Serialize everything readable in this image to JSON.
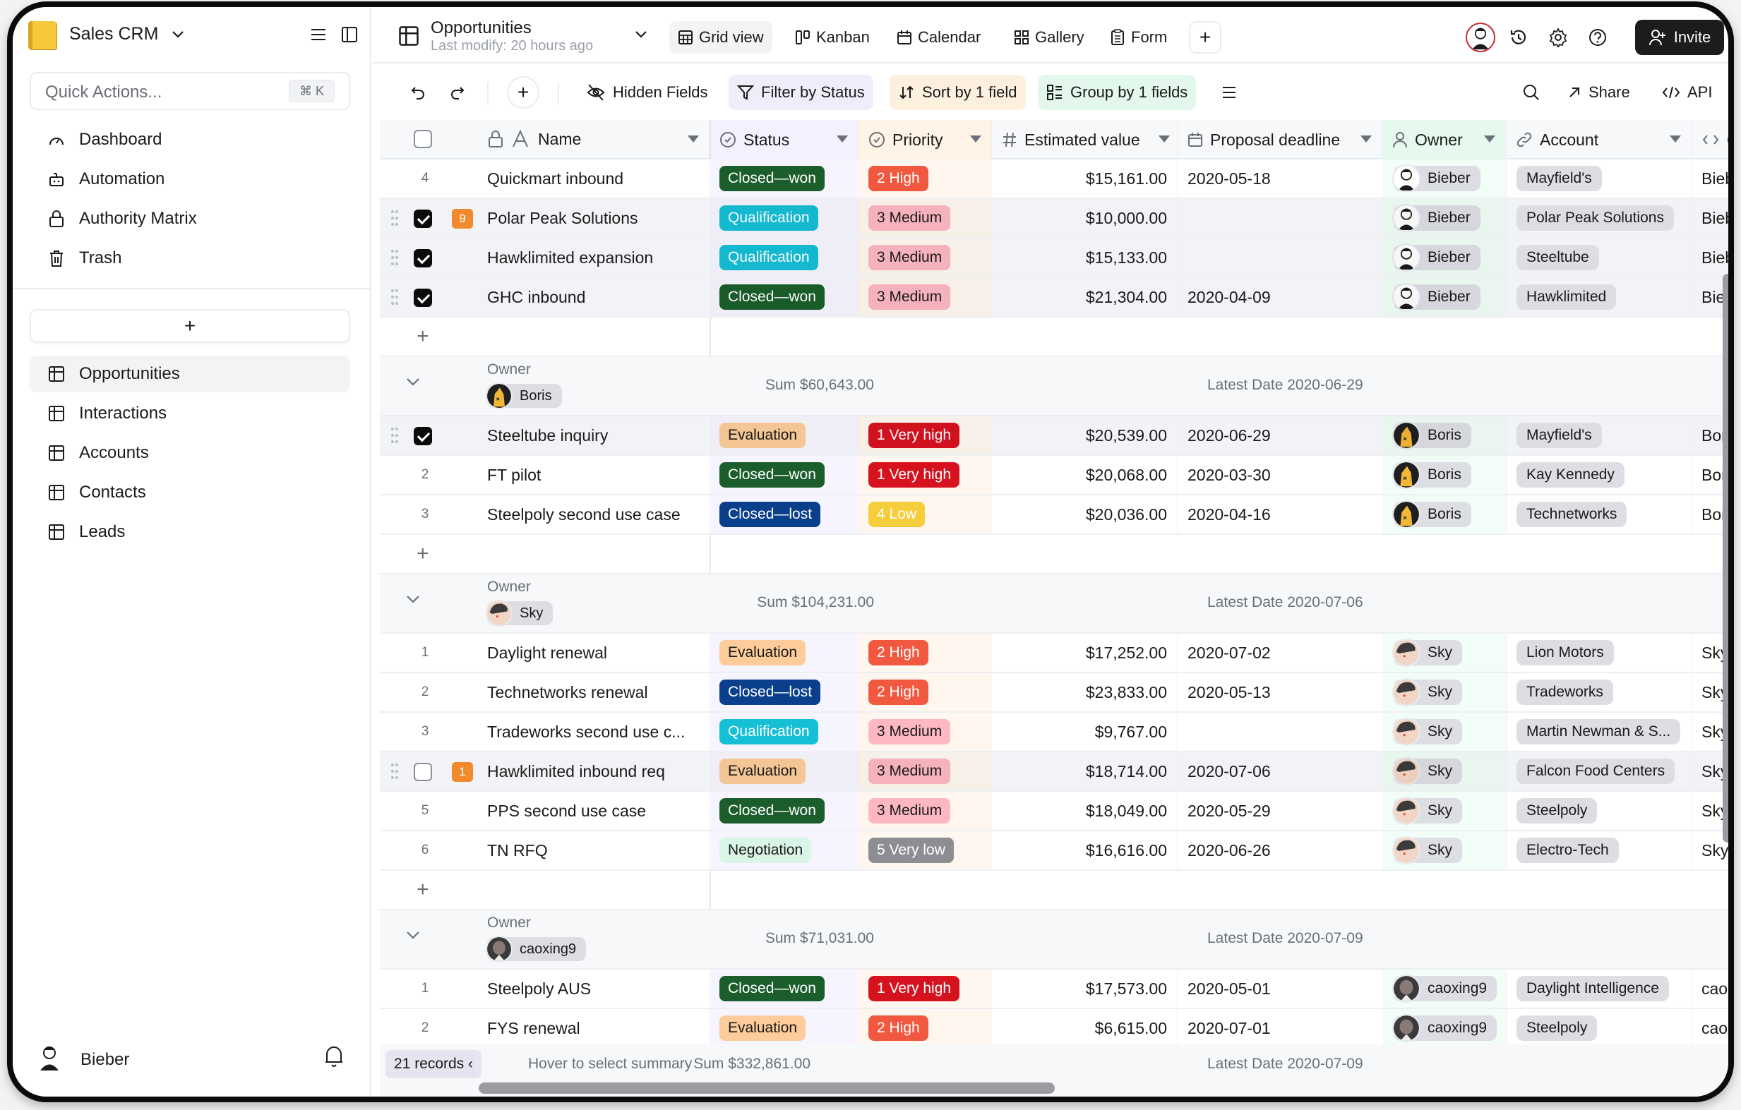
{
  "app": {
    "title": "Sales CRM",
    "quick_actions_placeholder": "Quick Actions...",
    "quick_actions_shortcut": "⌘ K",
    "nav": [
      {
        "label": "Dashboard",
        "icon": "dashboard-icon"
      },
      {
        "label": "Automation",
        "icon": "robot-icon"
      },
      {
        "label": "Authority Matrix",
        "icon": "lock-icon"
      },
      {
        "label": "Trash",
        "icon": "trash-icon"
      }
    ],
    "add_sheet_label": "+",
    "sheets": [
      {
        "label": "Opportunities",
        "active": true
      },
      {
        "label": "Interactions",
        "active": false
      },
      {
        "label": "Accounts",
        "active": false
      },
      {
        "label": "Contacts",
        "active": false
      },
      {
        "label": "Leads",
        "active": false
      }
    ],
    "current_user": "Bieber"
  },
  "header": {
    "sheet_title": "Opportunities",
    "last_modified": "Last modify: 20 hours ago",
    "views": [
      {
        "label": "Grid view",
        "active": true
      },
      {
        "label": "Kanban",
        "active": false
      },
      {
        "label": "Calendar",
        "active": false
      },
      {
        "label": "Gallery",
        "active": false
      },
      {
        "label": "Form",
        "active": false
      }
    ],
    "add_view": "+",
    "invite_label": "Invite"
  },
  "toolbar": {
    "add": "+",
    "hidden_fields": "Hidden Fields",
    "filter": "Filter by Status",
    "sort": "Sort by 1 field",
    "group": "Group by 1 fields",
    "share": "Share",
    "api": "API"
  },
  "columns": {
    "name": "Name",
    "status": "Status",
    "priority": "Priority",
    "estimated_value": "Estimated value",
    "proposal_deadline": "Proposal deadline",
    "owner": "Owner",
    "account": "Account",
    "owner_formula": "Ov"
  },
  "colors": {
    "status": {
      "Closed—won": {
        "bg": "#1b5e2b",
        "fg": "#ffffff"
      },
      "Closed—lost": {
        "bg": "#0a3f8c",
        "fg": "#ffffff"
      },
      "Qualification": {
        "bg": "#15bfd6",
        "fg": "#ffffff"
      },
      "Evaluation": {
        "bg": "#fdcc9a",
        "fg": "#1a1a1a"
      },
      "Negotiation": {
        "bg": "#d8f5e6",
        "fg": "#1a1a1a"
      }
    },
    "priority": {
      "1 Very high": {
        "bg": "#d6121f",
        "fg": "#ffffff"
      },
      "2 High": {
        "bg": "#f0583f",
        "fg": "#ffffff"
      },
      "3 Medium": {
        "bg": "#fdb8c2",
        "fg": "#1a1a1a"
      },
      "4 Low": {
        "bg": "#f6cd3a",
        "fg": "#ffffff"
      },
      "5 Very low": {
        "bg": "#8c8e94",
        "fg": "#ffffff"
      }
    },
    "avatars": {
      "Bieber": "#ffffff",
      "Boris": "#f2b733",
      "Sky": "#f1d6c6",
      "caoxing9": "#8a7a76"
    }
  },
  "group_label": "Owner",
  "partial_group": {
    "rows": [
      {
        "num": "4",
        "selected": false,
        "checked": false,
        "comments": "",
        "name": "Quickmart inbound",
        "status": "Closed—won",
        "priority": "2 High",
        "value": "$15,161.00",
        "deadline": "2020-05-18",
        "owner": "Bieber",
        "account": "Mayfield's",
        "ov": "Bieber"
      },
      {
        "num": "",
        "selected": true,
        "checked": true,
        "comments": "9",
        "name": "Polar Peak Solutions",
        "status": "Qualification",
        "priority": "3 Medium",
        "value": "$10,000.00",
        "deadline": "",
        "owner": "Bieber",
        "account": "Polar Peak Solutions",
        "ov": "Bieber"
      },
      {
        "num": "",
        "selected": true,
        "checked": true,
        "comments": "",
        "name": "Hawklimited expansion",
        "status": "Qualification",
        "priority": "3 Medium",
        "value": "$15,133.00",
        "deadline": "",
        "owner": "Bieber",
        "account": "Steeltube",
        "ov": "Bieber"
      },
      {
        "num": "",
        "selected": true,
        "checked": true,
        "comments": "",
        "name": "GHC inbound",
        "status": "Closed—won",
        "priority": "3 Medium",
        "value": "$21,304.00",
        "deadline": "2020-04-09",
        "owner": "Bieber",
        "account": "Hawklimited",
        "ov": "Bieber"
      }
    ]
  },
  "groups": [
    {
      "owner": "Boris",
      "sum": "Sum $60,643.00",
      "latest": "Latest Date 2020-06-29",
      "rows": [
        {
          "num": "",
          "selected": true,
          "checked": true,
          "comments": "",
          "name": "Steeltube inquiry",
          "status": "Evaluation",
          "priority": "1 Very high",
          "value": "$20,539.00",
          "deadline": "2020-06-29",
          "owner": "Boris",
          "account": "Mayfield's",
          "ov": "Boris"
        },
        {
          "num": "2",
          "selected": false,
          "checked": false,
          "comments": "",
          "name": "FT pilot",
          "status": "Closed—won",
          "priority": "1 Very high",
          "value": "$20,068.00",
          "deadline": "2020-03-30",
          "owner": "Boris",
          "account": "Kay Kennedy",
          "ov": "Boris"
        },
        {
          "num": "3",
          "selected": false,
          "checked": false,
          "comments": "",
          "name": "Steelpoly second use case",
          "status": "Closed—lost",
          "priority": "4 Low",
          "value": "$20,036.00",
          "deadline": "2020-04-16",
          "owner": "Boris",
          "account": "Technetworks",
          "ov": "Boris"
        }
      ]
    },
    {
      "owner": "Sky",
      "sum": "Sum $104,231.00",
      "latest": "Latest Date 2020-07-06",
      "rows": [
        {
          "num": "1",
          "selected": false,
          "checked": false,
          "comments": "",
          "name": "Daylight renewal",
          "status": "Evaluation",
          "priority": "2 High",
          "value": "$17,252.00",
          "deadline": "2020-07-02",
          "owner": "Sky",
          "account": "Lion Motors",
          "ov": "Sky"
        },
        {
          "num": "2",
          "selected": false,
          "checked": false,
          "comments": "",
          "name": "Technetworks renewal",
          "status": "Closed—lost",
          "priority": "2 High",
          "value": "$23,833.00",
          "deadline": "2020-05-13",
          "owner": "Sky",
          "account": "Tradeworks",
          "ov": "Sky"
        },
        {
          "num": "3",
          "selected": false,
          "checked": false,
          "comments": "",
          "name": "Tradeworks second use c...",
          "status": "Qualification",
          "priority": "3 Medium",
          "value": "$9,767.00",
          "deadline": "",
          "owner": "Sky",
          "account": "Martin Newman & S...",
          "ov": "Sky"
        },
        {
          "num": "",
          "selected": true,
          "checked": false,
          "comments": "1",
          "name": "Hawklimited inbound req",
          "status": "Evaluation",
          "priority": "3 Medium",
          "value": "$18,714.00",
          "deadline": "2020-07-06",
          "owner": "Sky",
          "account": "Falcon Food Centers",
          "ov": "Sky"
        },
        {
          "num": "5",
          "selected": false,
          "checked": false,
          "comments": "",
          "name": "PPS second use case",
          "status": "Closed—won",
          "priority": "3 Medium",
          "value": "$18,049.00",
          "deadline": "2020-05-29",
          "owner": "Sky",
          "account": "Steelpoly",
          "ov": "Sky"
        },
        {
          "num": "6",
          "selected": false,
          "checked": false,
          "comments": "",
          "name": "TN RFQ",
          "status": "Negotiation",
          "priority": "5 Very low",
          "value": "$16,616.00",
          "deadline": "2020-06-26",
          "owner": "Sky",
          "account": "Electro-Tech",
          "ov": "Sky"
        }
      ]
    },
    {
      "owner": "caoxing9",
      "sum": "Sum $71,031.00",
      "latest": "Latest Date 2020-07-09",
      "rows": [
        {
          "num": "1",
          "selected": false,
          "checked": false,
          "comments": "",
          "name": "Steelpoly AUS",
          "status": "Closed—won",
          "priority": "1 Very high",
          "value": "$17,573.00",
          "deadline": "2020-05-01",
          "owner": "caoxing9",
          "account": "Daylight Intelligence",
          "ov": "caoxi"
        },
        {
          "num": "2",
          "selected": false,
          "checked": false,
          "comments": "",
          "name": "FYS renewal",
          "status": "Evaluation",
          "priority": "2 High",
          "value": "$6,615.00",
          "deadline": "2020-07-01",
          "owner": "caoxing9",
          "account": "Steelpoly",
          "ov": "caoxi"
        }
      ]
    }
  ],
  "footer": {
    "records": "21 records",
    "hover_hint": "Hover to select summary",
    "sum": "Sum $332,861.00",
    "latest": "Latest Date 2020-07-09"
  }
}
